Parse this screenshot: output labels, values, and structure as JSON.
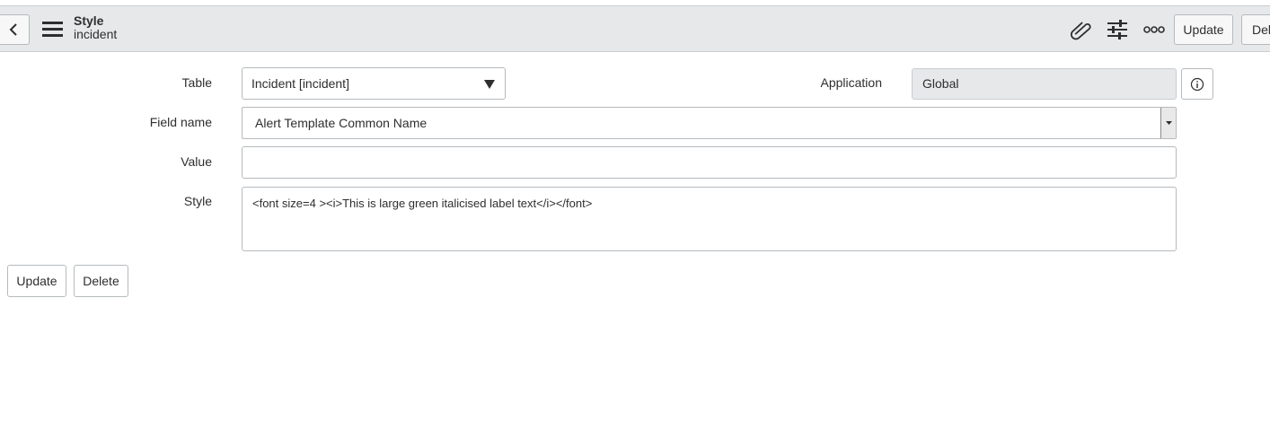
{
  "header": {
    "title": "Style",
    "subtitle": "incident",
    "icons": [
      "chevron-left-icon",
      "hamburger-menu-icon",
      "paperclip-icon",
      "sliders-icon",
      "more-icon"
    ],
    "buttons": {
      "update": "Update",
      "delete": "Delete"
    }
  },
  "form": {
    "table": {
      "label": "Table",
      "value": "Incident [incident]"
    },
    "application": {
      "label": "Application",
      "value": "Global"
    },
    "field_name": {
      "label": "Field name",
      "value": "Alert Template Common Name"
    },
    "value": {
      "label": "Value",
      "value": ""
    },
    "style": {
      "label": "Style",
      "value": "<font size=4 ><i>This is large green italicised label text</i></font>"
    }
  },
  "footer": {
    "update": "Update",
    "delete": "Delete"
  },
  "colors": {
    "header_bg": "#e6e8ea",
    "border": "#b6babe",
    "readonly_bg": "#e6e8ea",
    "text": "#2e2e2e"
  }
}
